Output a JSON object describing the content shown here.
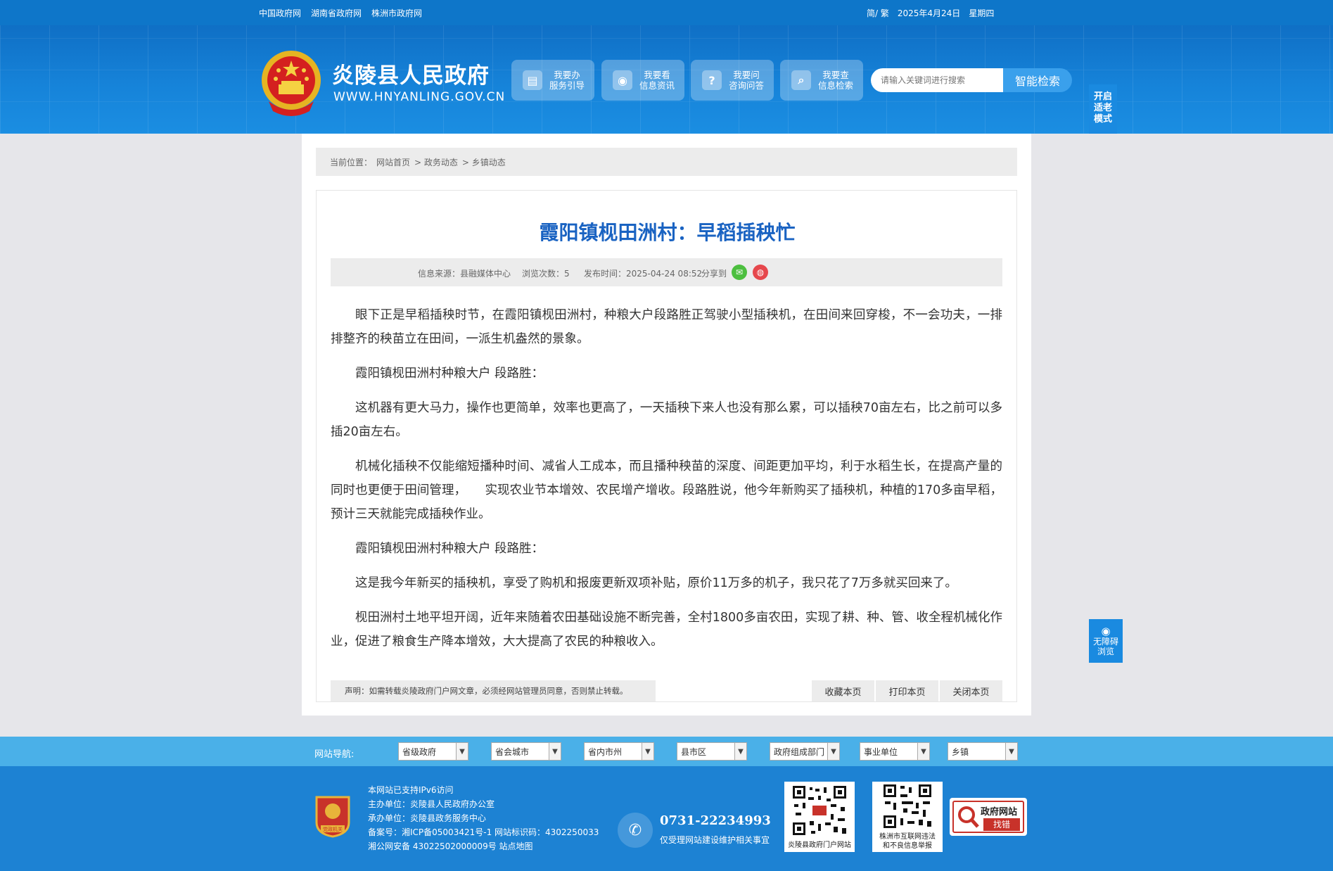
{
  "topbar": {
    "links": [
      "中国政府网",
      "湖南省政府网",
      "株洲市政府网"
    ],
    "lang": "简/ 繁",
    "date": "2025年4月24日",
    "weekday": "星期四"
  },
  "header": {
    "site_name": "炎陵县人民政府",
    "site_url": "WWW.HNYANLING.GOV.CN",
    "services": [
      {
        "title": "我要办",
        "sub": "服务引导"
      },
      {
        "title": "我要看",
        "sub": "信息资讯"
      },
      {
        "title": "我要问",
        "sub": "咨询问答"
      },
      {
        "title": "我要查",
        "sub": "信息检索"
      }
    ],
    "search_placeholder": "请输入关键词进行搜索",
    "search_button": "智能检索",
    "elder_mode": [
      "开启",
      "适老",
      "模式"
    ]
  },
  "breadcrumb": {
    "label": "当前位置：",
    "items": [
      "网站首页",
      "> 政务动态",
      "> 乡镇动态"
    ]
  },
  "article": {
    "title": "霞阳镇枧田洲村：早稻插秧忙",
    "source": "信息来源：县融媒体中心",
    "views": "浏览次数：5",
    "publish": "发布时间：2025-04-24 08:52",
    "share": "分享到",
    "paragraphs": [
      "眼下正是早稻插秧时节，在霞阳镇枧田洲村，种粮大户段路胜正驾驶小型插秧机，在田间来回穿梭，不一会功夫，一排排整齐的秧苗立在田间，一派生机盎然的景象。",
      "霞阳镇枧田洲村种粮大户  段路胜：",
      "这机器有更大马力，操作也更简单，效率也更高了，一天插秧下来人也没有那么累，可以插秧70亩左右，比之前可以多插20亩左右。",
      "机械化插秧不仅能缩短播种时间、减省人工成本，而且播种秧苗的深度、间距更加平均，利于水稻生长，在提高产量的同时也更便于田间管理，　　实现农业节本增效、农民增产增收。段路胜说，他今年新购买了插秧机，种植的170多亩早稻，预计三天就能完成插秧作业。",
      "霞阳镇枧田洲村种粮大户  段路胜：",
      "这是我今年新买的插秧机，享受了购机和报废更新双项补贴，原价11万多的机子，我只花了7万多就买回来了。",
      "枧田洲村土地平坦开阔，近年来随着农田基础设施不断完善，全村1800多亩农田，实现了耕、种、管、收全程机械化作业，促进了粮食生产降本增效，大大提高了农民的种粮收入。"
    ],
    "declaration": "声明：如需转载炎陵政府门户网文章，必须经网站管理员同意，否则禁止转载。",
    "actions": [
      "收藏本页",
      "打印本页",
      "关闭本页"
    ]
  },
  "accessibility": [
    "无障碍",
    "浏览"
  ],
  "site_nav": {
    "label": "网站导航:",
    "selects": [
      "省级政府",
      "省会城市",
      "省内市州",
      "县市区",
      "政府组成部门",
      "事业单位",
      "乡镇"
    ]
  },
  "footer": {
    "badge_text": "党政机关",
    "info": [
      "本网站已支持IPv6访问",
      "主办单位：炎陵县人民政府办公室",
      "承办单位：炎陵县政务服务中心",
      "备案号：湘ICP备05003421号-1 网站标识码：4302250033",
      "湘公网安备 43022502000009号 站点地图"
    ],
    "phone": "0731-22234993",
    "phone_note": "仅受理网站建设维护相关事宜",
    "qr1_caption": "炎陵县政府门户网站",
    "qr2_caption": [
      "株洲市互联网违法",
      "和不良信息举报"
    ],
    "error_report": [
      "政府网站",
      "找错"
    ]
  },
  "colors": {
    "topbar": "#0e76c9",
    "header": "#1683d9",
    "title_blue": "#1a63c2",
    "nav_bar": "#4ab0e8",
    "footer": "#1d82d3"
  }
}
